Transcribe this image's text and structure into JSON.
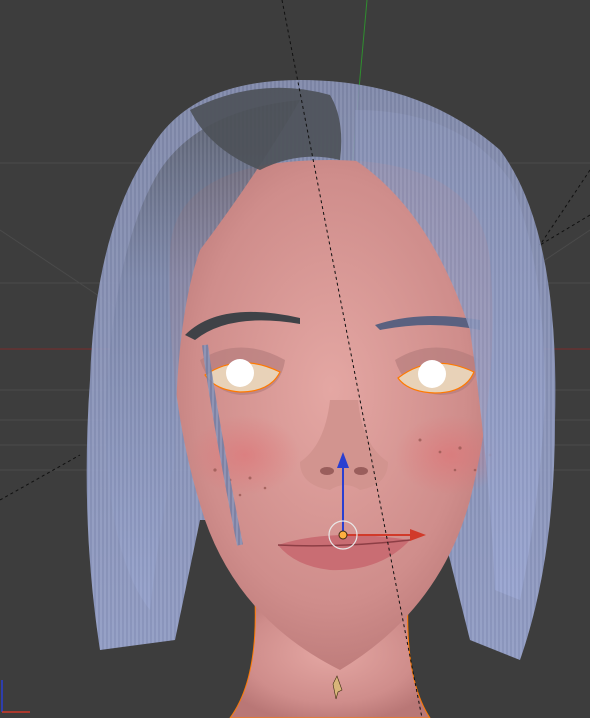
{
  "viewport": {
    "background": "#3d3d3d",
    "grid_color": "#4a4a4a",
    "axis_x_color": "#8a2a2a",
    "axis_y_color": "#2f8f2f",
    "axis_z_color": "#2a3fd1",
    "selection_outline": "#ff7a00"
  },
  "scene": {
    "object": "head-with-hair-particles",
    "skin_color": "#d99a9a",
    "hair_color": "#8a95b8",
    "hair_dark": "#5a5d66",
    "eye_white": "#ffffff"
  },
  "gizmo": {
    "type": "translate",
    "icons": [
      "x-arrow-icon",
      "z-arrow-icon",
      "pivot-icon"
    ]
  }
}
